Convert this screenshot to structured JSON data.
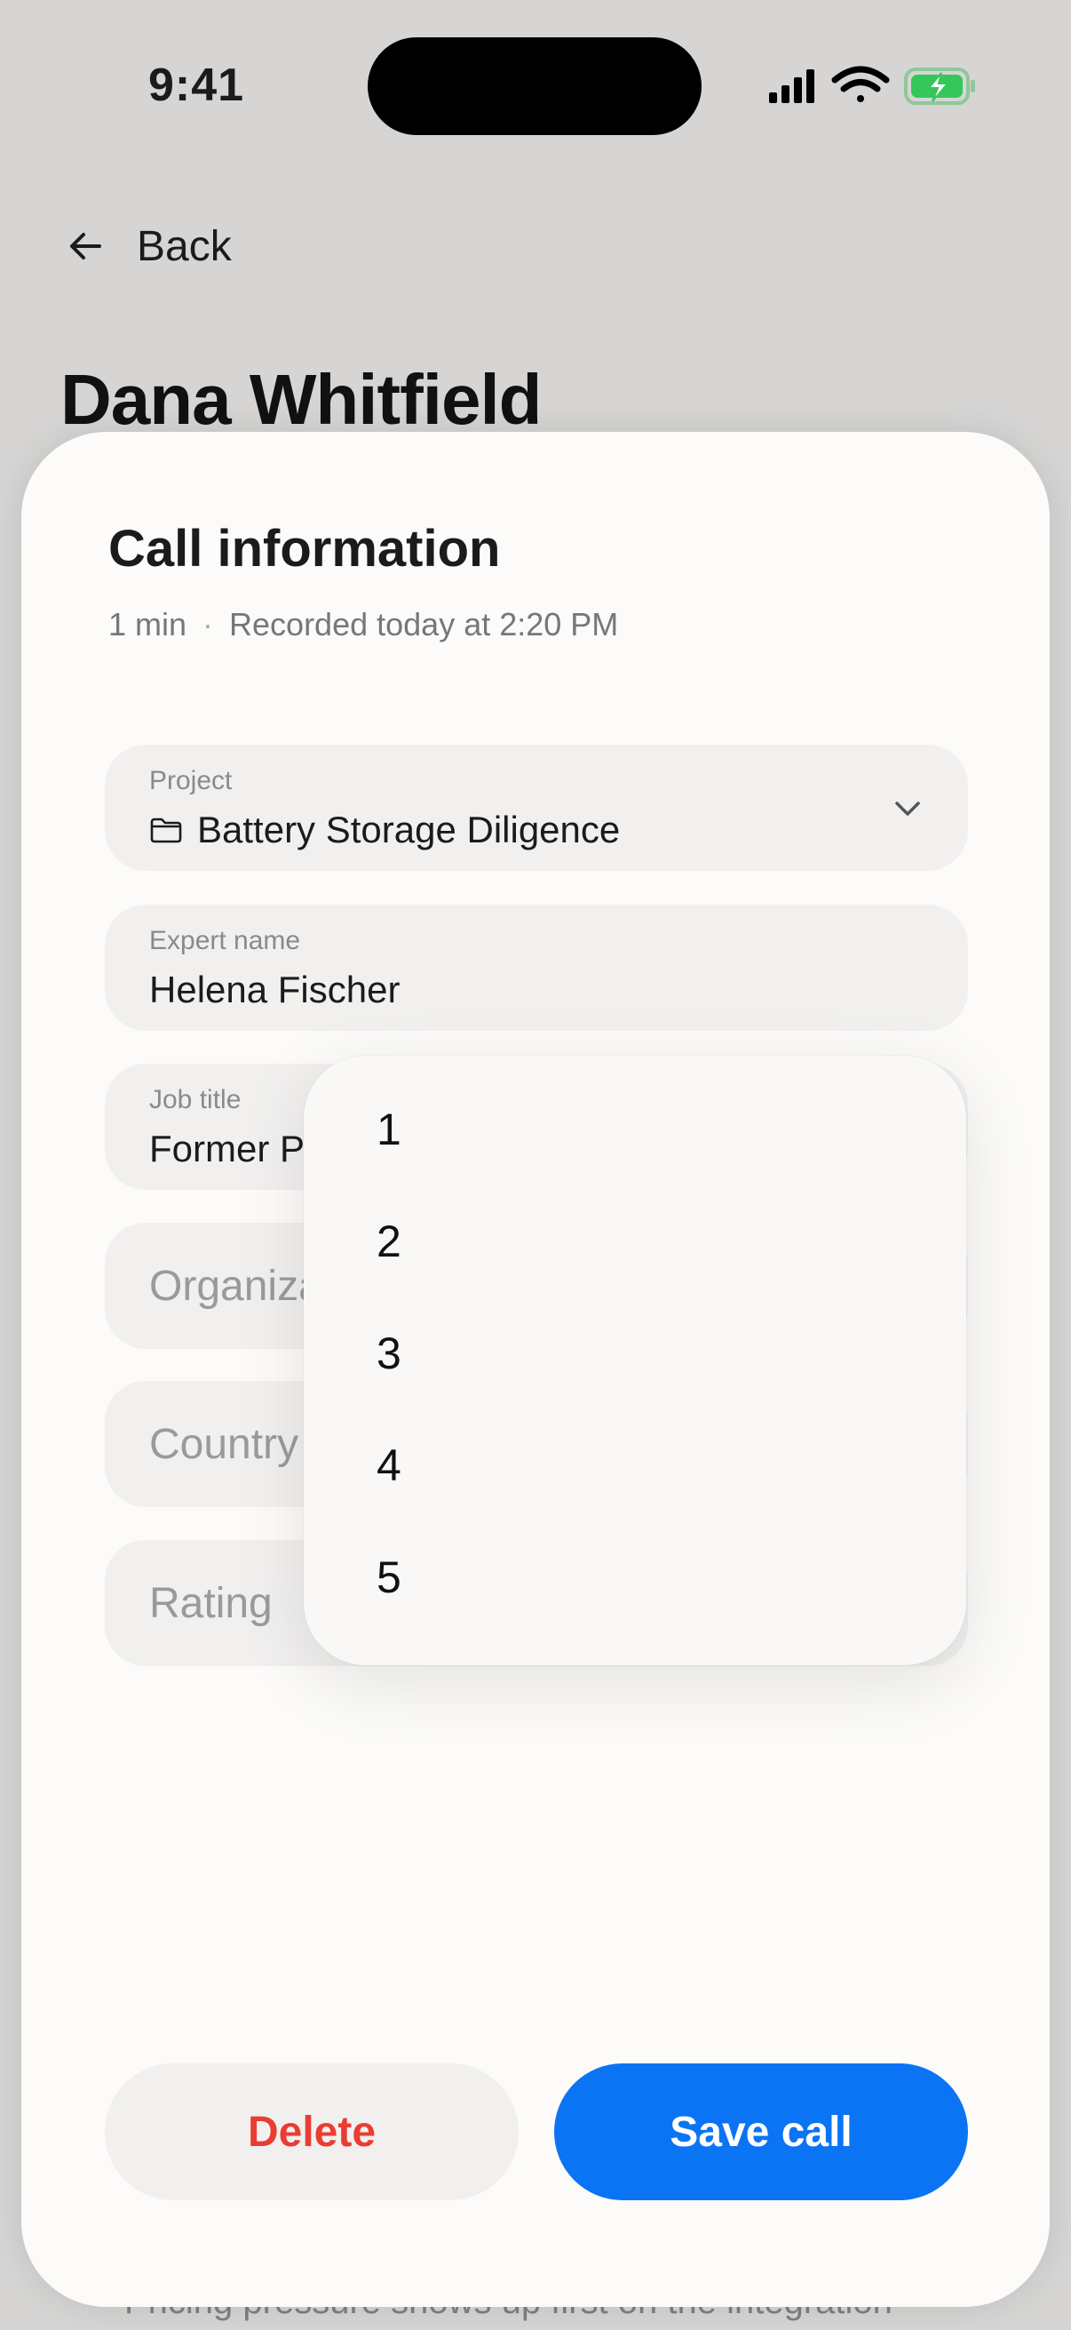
{
  "status_bar": {
    "time": "9:41"
  },
  "nav": {
    "back_label": "Back"
  },
  "person": {
    "name": "Dana Whitfield"
  },
  "background_note": "Pricing pressure shows up first on the integration",
  "sheet": {
    "title": "Call information",
    "duration": "1 min",
    "separator": "·",
    "recorded": "Recorded today at 2:20 PM"
  },
  "fields": {
    "project": {
      "label": "Project",
      "value": "Battery Storage Diligence"
    },
    "expert_name": {
      "label": "Expert name",
      "value": "Helena Fischer"
    },
    "job_title": {
      "label": "Job title",
      "value": "Former Project Manager"
    },
    "organization": {
      "placeholder": "Organization"
    },
    "country": {
      "placeholder": "Country"
    },
    "rating": {
      "placeholder": "Rating"
    }
  },
  "rating_dropdown": {
    "options": [
      "1",
      "2",
      "3",
      "4",
      "5"
    ]
  },
  "actions": {
    "delete_label": "Delete",
    "save_label": "Save call"
  },
  "colors": {
    "accent": "#0a74f4",
    "danger": "#ea3c32",
    "battery": "#34c759",
    "sheet_bg": "#fcfbf9",
    "field_bg": "#f1f0ef"
  },
  "icons": {
    "back": "arrow-left-icon",
    "project": "folder-icon",
    "project_chevron": "chevron-down-icon"
  }
}
